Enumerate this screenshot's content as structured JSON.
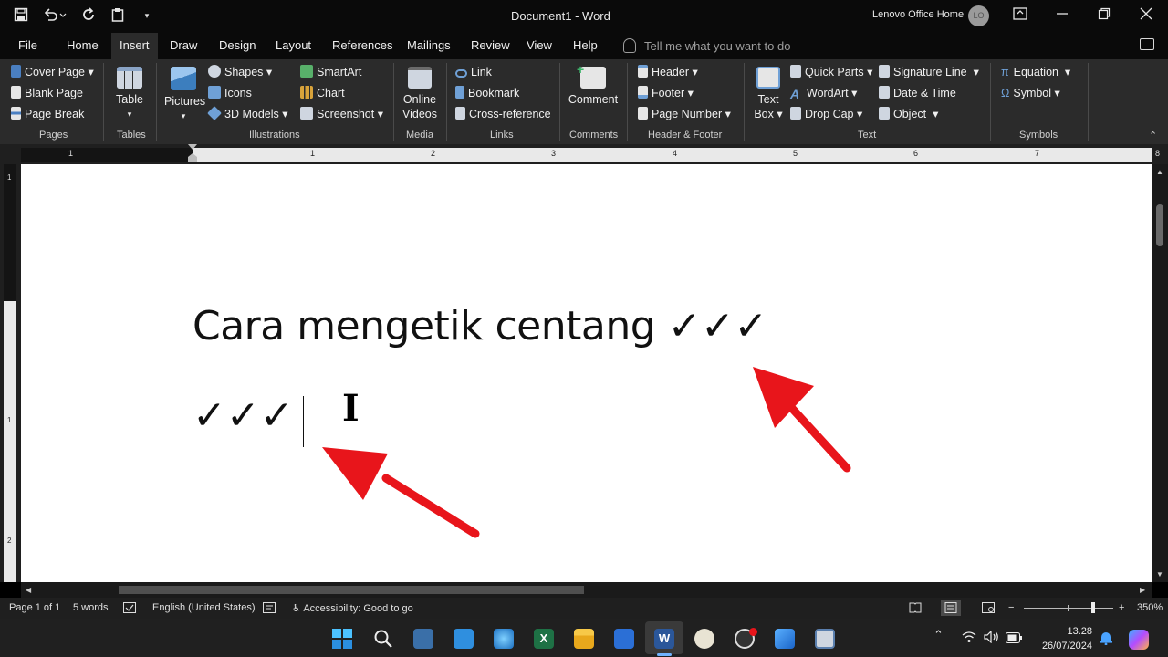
{
  "titlebar": {
    "document_title": "Document1  -  Word",
    "account_name": "Lenovo Office Home",
    "avatar_initials": "LO"
  },
  "menu": {
    "tabs": [
      "File",
      "Home",
      "Insert",
      "Draw",
      "Design",
      "Layout",
      "References",
      "Mailings",
      "Review",
      "View",
      "Help"
    ],
    "active_tab": "Insert",
    "tell_me_placeholder": "Tell me what you want to do"
  },
  "ribbon": {
    "pages": {
      "cover_page": "Cover Page",
      "blank_page": "Blank Page",
      "page_break": "Page Break",
      "label": "Pages"
    },
    "tables": {
      "table": "Table",
      "label": "Tables"
    },
    "illustrations": {
      "pictures": "Pictures",
      "shapes": "Shapes",
      "icons": "Icons",
      "models": "3D Models",
      "smartart": "SmartArt",
      "chart": "Chart",
      "screenshot": "Screenshot",
      "label": "Illustrations"
    },
    "media": {
      "online_videos_1": "Online",
      "online_videos_2": "Videos",
      "label": "Media"
    },
    "links": {
      "link": "Link",
      "bookmark": "Bookmark",
      "cross_reference": "Cross-reference",
      "label": "Links"
    },
    "comments": {
      "comment": "Comment",
      "label": "Comments"
    },
    "header_footer": {
      "header": "Header",
      "footer": "Footer",
      "page_number": "Page Number",
      "label": "Header & Footer"
    },
    "text": {
      "text_box_1": "Text",
      "text_box_2": "Box",
      "quick_parts": "Quick Parts",
      "wordart": "WordArt",
      "drop_cap": "Drop Cap",
      "signature_line": "Signature Line",
      "date_time": "Date & Time",
      "object": "Object",
      "label": "Text"
    },
    "symbols": {
      "equation": "Equation",
      "symbol": "Symbol",
      "label": "Symbols"
    }
  },
  "ruler": {
    "dark_mark": "1",
    "numbers": [
      "1",
      "2",
      "3",
      "4",
      "5",
      "6",
      "7",
      "8"
    ]
  },
  "vruler": {
    "numbers": [
      "1",
      "1",
      "2"
    ]
  },
  "document": {
    "line1": "Cara mengetik centang ✓✓✓",
    "line2": "✓✓✓"
  },
  "status": {
    "page": "Page 1 of 1",
    "words": "5 words",
    "language": "English (United States)",
    "accessibility": "Accessibility: Good to go",
    "zoom": "350%",
    "zoom_level": 0.78
  },
  "taskbar": {
    "time": "13.28",
    "date": "26/07/2024"
  },
  "colors": {
    "word_blue": "#2b579a",
    "arrow_red": "#e8151b",
    "ribbon_bg": "#2b2b2b"
  }
}
